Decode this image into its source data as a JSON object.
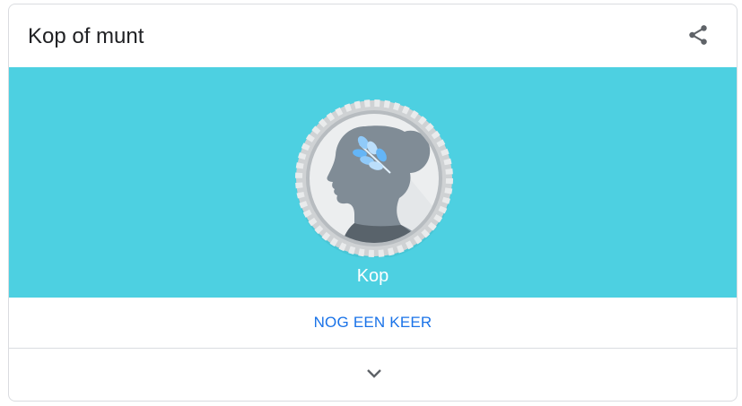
{
  "header": {
    "title": "Kop of munt"
  },
  "icons": {
    "share": "share-icon",
    "expand": "chevron-down-icon",
    "coin_face": "laurel-head-coin"
  },
  "colors": {
    "stage_background": "#4dd0e1",
    "action_text": "#1a73e8",
    "result_text": "#ffffff"
  },
  "coin": {
    "result_label": "Kop"
  },
  "actions": {
    "flip_again_label": "NOG EEN KEER"
  }
}
